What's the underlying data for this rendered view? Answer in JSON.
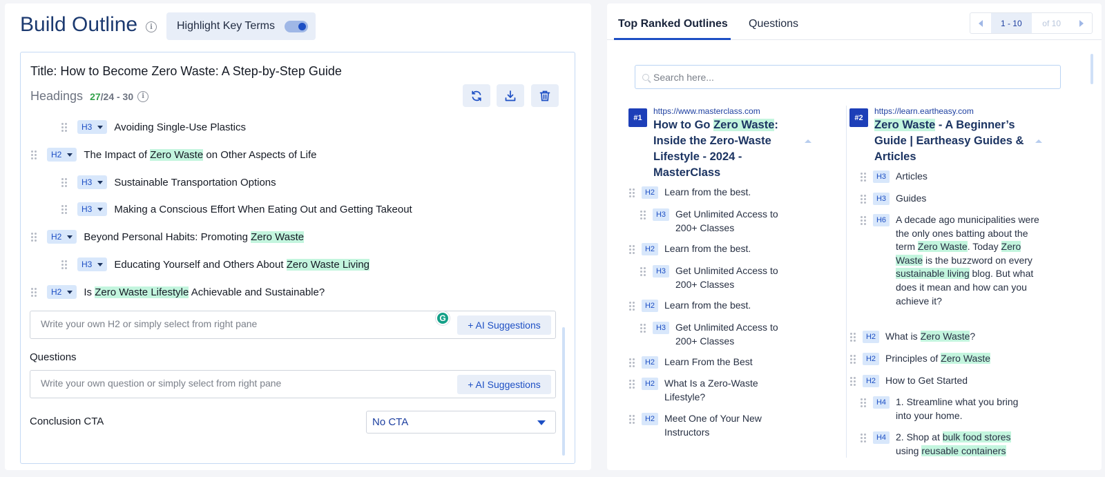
{
  "left": {
    "title": "Build Outline",
    "highlight_label": "Highlight Key Terms",
    "highlight_on": true,
    "doc_title": "Title: How to Become Zero Waste: A Step-by-Step Guide",
    "headings_label": "Headings",
    "headings_count": "27",
    "headings_range": "/24 - 30",
    "toolbar_icons": [
      "refresh-icon",
      "download-icon",
      "trash-icon"
    ],
    "headings": [
      {
        "level": "H3",
        "parts": [
          {
            "t": "Avoiding Single-Use Plastics"
          }
        ]
      },
      {
        "level": "H2",
        "parts": [
          {
            "t": "The Impact of "
          },
          {
            "t": "Zero Waste",
            "k": true
          },
          {
            "t": " on Other Aspects of Life"
          }
        ]
      },
      {
        "level": "H3",
        "parts": [
          {
            "t": "Sustainable Transportation Options"
          }
        ]
      },
      {
        "level": "H3",
        "parts": [
          {
            "t": "Making a Conscious Effort When Eating Out and Getting Takeout"
          }
        ]
      },
      {
        "level": "H2",
        "parts": [
          {
            "t": "Beyond Personal Habits: Promoting "
          },
          {
            "t": "Zero Waste",
            "k": true
          }
        ]
      },
      {
        "level": "H3",
        "parts": [
          {
            "t": "Educating Yourself and Others About "
          },
          {
            "t": "Zero Waste Living",
            "k": true
          }
        ]
      },
      {
        "level": "H2",
        "parts": [
          {
            "t": "Is "
          },
          {
            "t": "Zero Waste Lifestyle",
            "k": true
          },
          {
            "t": " Achievable and Sustainable?"
          }
        ]
      }
    ],
    "h2_placeholder": "Write your own H2 or simply select from right pane",
    "ai_suggestions_label": "+ AI Suggestions",
    "questions_label": "Questions",
    "question_placeholder": "Write your own question or simply select from right pane",
    "conclusion_label": "Conclusion CTA",
    "cta_value": "No CTA"
  },
  "right": {
    "tabs": [
      "Top Ranked Outlines",
      "Questions"
    ],
    "active_tab": 0,
    "pager": {
      "range": "1 - 10",
      "of": "of 10"
    },
    "search_placeholder": "Search here...",
    "outlines": [
      {
        "rank": "#1",
        "url": "https://www.masterclass.com",
        "title_parts": [
          {
            "t": "How to Go "
          },
          {
            "t": "Zero Waste",
            "k": true
          },
          {
            "t": ": Inside the Zero-Waste Lifestyle - 2024 - MasterClass"
          }
        ],
        "items": [
          {
            "level": "H2",
            "parts": [
              {
                "t": "Learn from the best."
              }
            ]
          },
          {
            "level": "H3",
            "parts": [
              {
                "t": "Get Unlimited Access to 200+ Classes"
              }
            ]
          },
          {
            "level": "H2",
            "parts": [
              {
                "t": "Learn from the best."
              }
            ]
          },
          {
            "level": "H3",
            "parts": [
              {
                "t": "Get Unlimited Access to 200+ Classes"
              }
            ]
          },
          {
            "level": "H2",
            "parts": [
              {
                "t": "Learn from the best."
              }
            ]
          },
          {
            "level": "H3",
            "parts": [
              {
                "t": "Get Unlimited Access to 200+ Classes"
              }
            ]
          },
          {
            "level": "H2",
            "parts": [
              {
                "t": "Learn From the Best"
              }
            ]
          },
          {
            "level": "H2",
            "parts": [
              {
                "t": "What Is a Zero-Waste Lifestyle?"
              }
            ]
          },
          {
            "level": "H2",
            "parts": [
              {
                "t": "Meet One of Your New Instructors"
              }
            ]
          }
        ]
      },
      {
        "rank": "#2",
        "url": "https://learn.eartheasy.com",
        "title_parts": [
          {
            "t": "Zero Waste",
            "k": true
          },
          {
            "t": " - A Beginner’s Guide | Eartheasy Guides & Articles"
          }
        ],
        "items": [
          {
            "level": "H3",
            "parts": [
              {
                "t": "Articles"
              }
            ]
          },
          {
            "level": "H3",
            "parts": [
              {
                "t": "Guides"
              }
            ]
          },
          {
            "level": "H6",
            "parts": [
              {
                "t": "A decade ago municipalities were the only ones batting about the term "
              },
              {
                "t": "Zero Waste",
                "k": true
              },
              {
                "t": ". Today "
              },
              {
                "t": "Zero Waste",
                "k": true
              },
              {
                "t": " is the buzzword on every "
              },
              {
                "t": "sustainable living",
                "k": true
              },
              {
                "t": " blog. But what does it mean and how can you achieve it?"
              }
            ]
          },
          {
            "level": "H2",
            "parts": [
              {
                "t": "What is "
              },
              {
                "t": "Zero Waste",
                "k": true
              },
              {
                "t": "?"
              }
            ]
          },
          {
            "level": "H2",
            "parts": [
              {
                "t": "Principles of "
              },
              {
                "t": "Zero Waste",
                "k": true
              }
            ]
          },
          {
            "level": "H2",
            "parts": [
              {
                "t": "How to Get Started"
              }
            ]
          },
          {
            "level": "H4",
            "parts": [
              {
                "t": "1. Streamline what you bring into your home."
              }
            ]
          },
          {
            "level": "H4",
            "parts": [
              {
                "t": "2. Shop at "
              },
              {
                "t": "bulk food stores",
                "k": true
              },
              {
                "t": " using "
              },
              {
                "t": "reusable containers",
                "k": true
              }
            ]
          }
        ]
      }
    ]
  }
}
